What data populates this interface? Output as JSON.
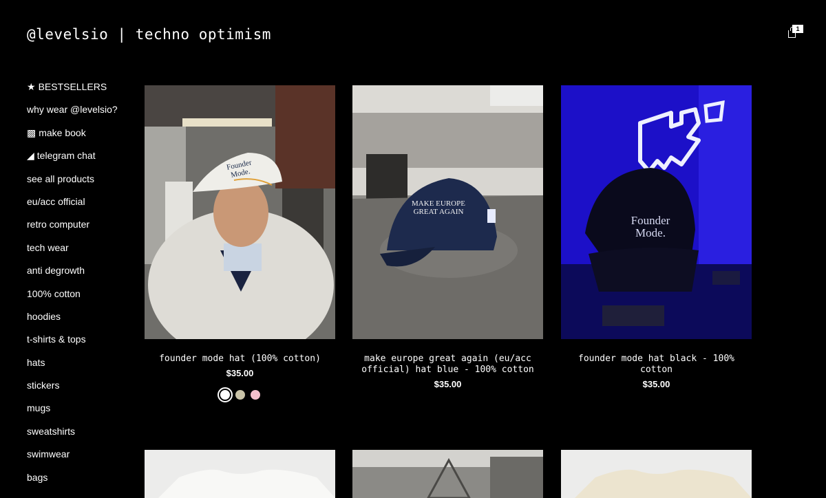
{
  "site": {
    "title": "@levelsio | techno optimism",
    "cart_count": "1"
  },
  "sidebar": {
    "items": [
      {
        "glyph": "★",
        "label": "BESTSELLERS"
      },
      {
        "glyph": "",
        "label": "why wear @levelsio?"
      },
      {
        "glyph": "▩",
        "label": "make book"
      },
      {
        "glyph": "◢",
        "label": "telegram chat"
      },
      {
        "glyph": "",
        "label": "see all products"
      },
      {
        "glyph": "",
        "label": "eu/acc official"
      },
      {
        "glyph": "",
        "label": "retro computer"
      },
      {
        "glyph": "",
        "label": "tech wear"
      },
      {
        "glyph": "",
        "label": "anti degrowth"
      },
      {
        "glyph": "",
        "label": "100% cotton"
      },
      {
        "glyph": "",
        "label": "hoodies"
      },
      {
        "glyph": "",
        "label": "t-shirts & tops"
      },
      {
        "glyph": "",
        "label": "hats"
      },
      {
        "glyph": "",
        "label": "stickers"
      },
      {
        "glyph": "",
        "label": "mugs"
      },
      {
        "glyph": "",
        "label": "sweatshirts"
      },
      {
        "glyph": "",
        "label": "swimwear"
      },
      {
        "glyph": "",
        "label": "bags"
      }
    ]
  },
  "products": [
    {
      "name": "founder mode hat (100% cotton)",
      "price": "$35.00",
      "image_text": [
        "Founder",
        "Mode."
      ],
      "swatches": [
        "#ffffff",
        "#c9c3a8",
        "#f4c0cc"
      ]
    },
    {
      "name": "make europe great again (eu/acc official) hat blue - 100% cotton",
      "price": "$35.00",
      "image_text": [
        "MAKE EUROPE",
        "GREAT AGAIN"
      ]
    },
    {
      "name": "founder mode hat black - 100% cotton",
      "price": "$35.00",
      "image_text": [
        "Founder",
        "Mode."
      ]
    }
  ],
  "colors": {
    "background": "#000000",
    "text": "#ffffff",
    "neon": "#2a22ff"
  }
}
